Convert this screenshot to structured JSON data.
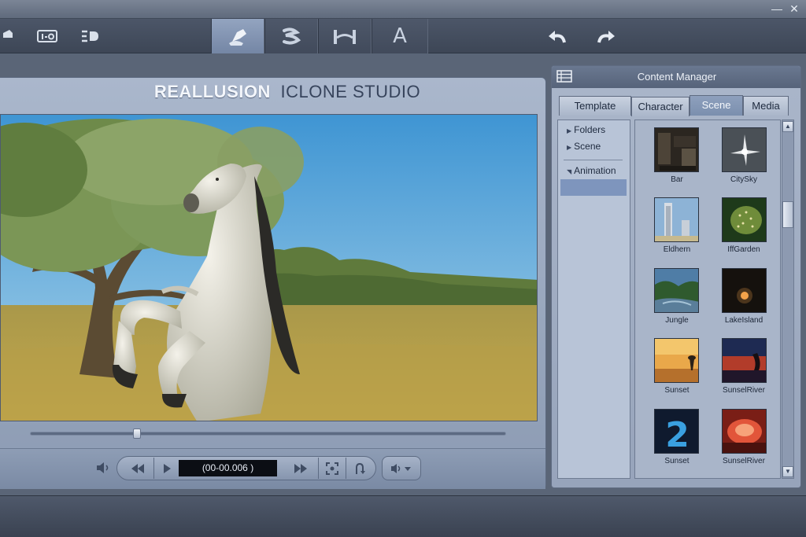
{
  "window": {
    "minimize_glyph": "—",
    "close_glyph": "✕"
  },
  "toolbar": {
    "icons": [
      "stage-icon",
      "io-icon",
      "3d-icon",
      "actor-tab-icon",
      "animation-tab-icon",
      "path-tab-icon",
      "text-tab-icon",
      "undo-icon",
      "redo-icon"
    ],
    "text_tab_letter": "A",
    "active_tab": "actor"
  },
  "viewport": {
    "brand": "REALLUSION",
    "product": "ICLONE STUDIO",
    "scrub_position": 0.22
  },
  "transport": {
    "time": "(00-00.006 )"
  },
  "content_manager": {
    "title": "Content Manager",
    "tabs": [
      {
        "label": "Template"
      },
      {
        "label": "Character"
      },
      {
        "label": "Scene"
      },
      {
        "label": "Media"
      }
    ],
    "active_tab": "Scene",
    "tree": [
      {
        "label": "Folders"
      },
      {
        "label": "Scene"
      },
      {
        "label": "Animation"
      }
    ],
    "items": [
      {
        "label": "Bar"
      },
      {
        "label": "CitySky"
      },
      {
        "label": "Eldhern"
      },
      {
        "label": "IffGarden"
      },
      {
        "label": "Jungle"
      },
      {
        "label": "LakeIsland"
      },
      {
        "label": "Sunset"
      },
      {
        "label": "SunselRiver"
      },
      {
        "label": "Sunset"
      },
      {
        "label": "SunselRiver"
      }
    ],
    "thumb_2_glyph": "2"
  },
  "colors": {
    "active_tab": "#7b8fae",
    "timecode_bg": "#0b0e14",
    "sky": "#5aa8d8",
    "field": "#b8a04a"
  }
}
